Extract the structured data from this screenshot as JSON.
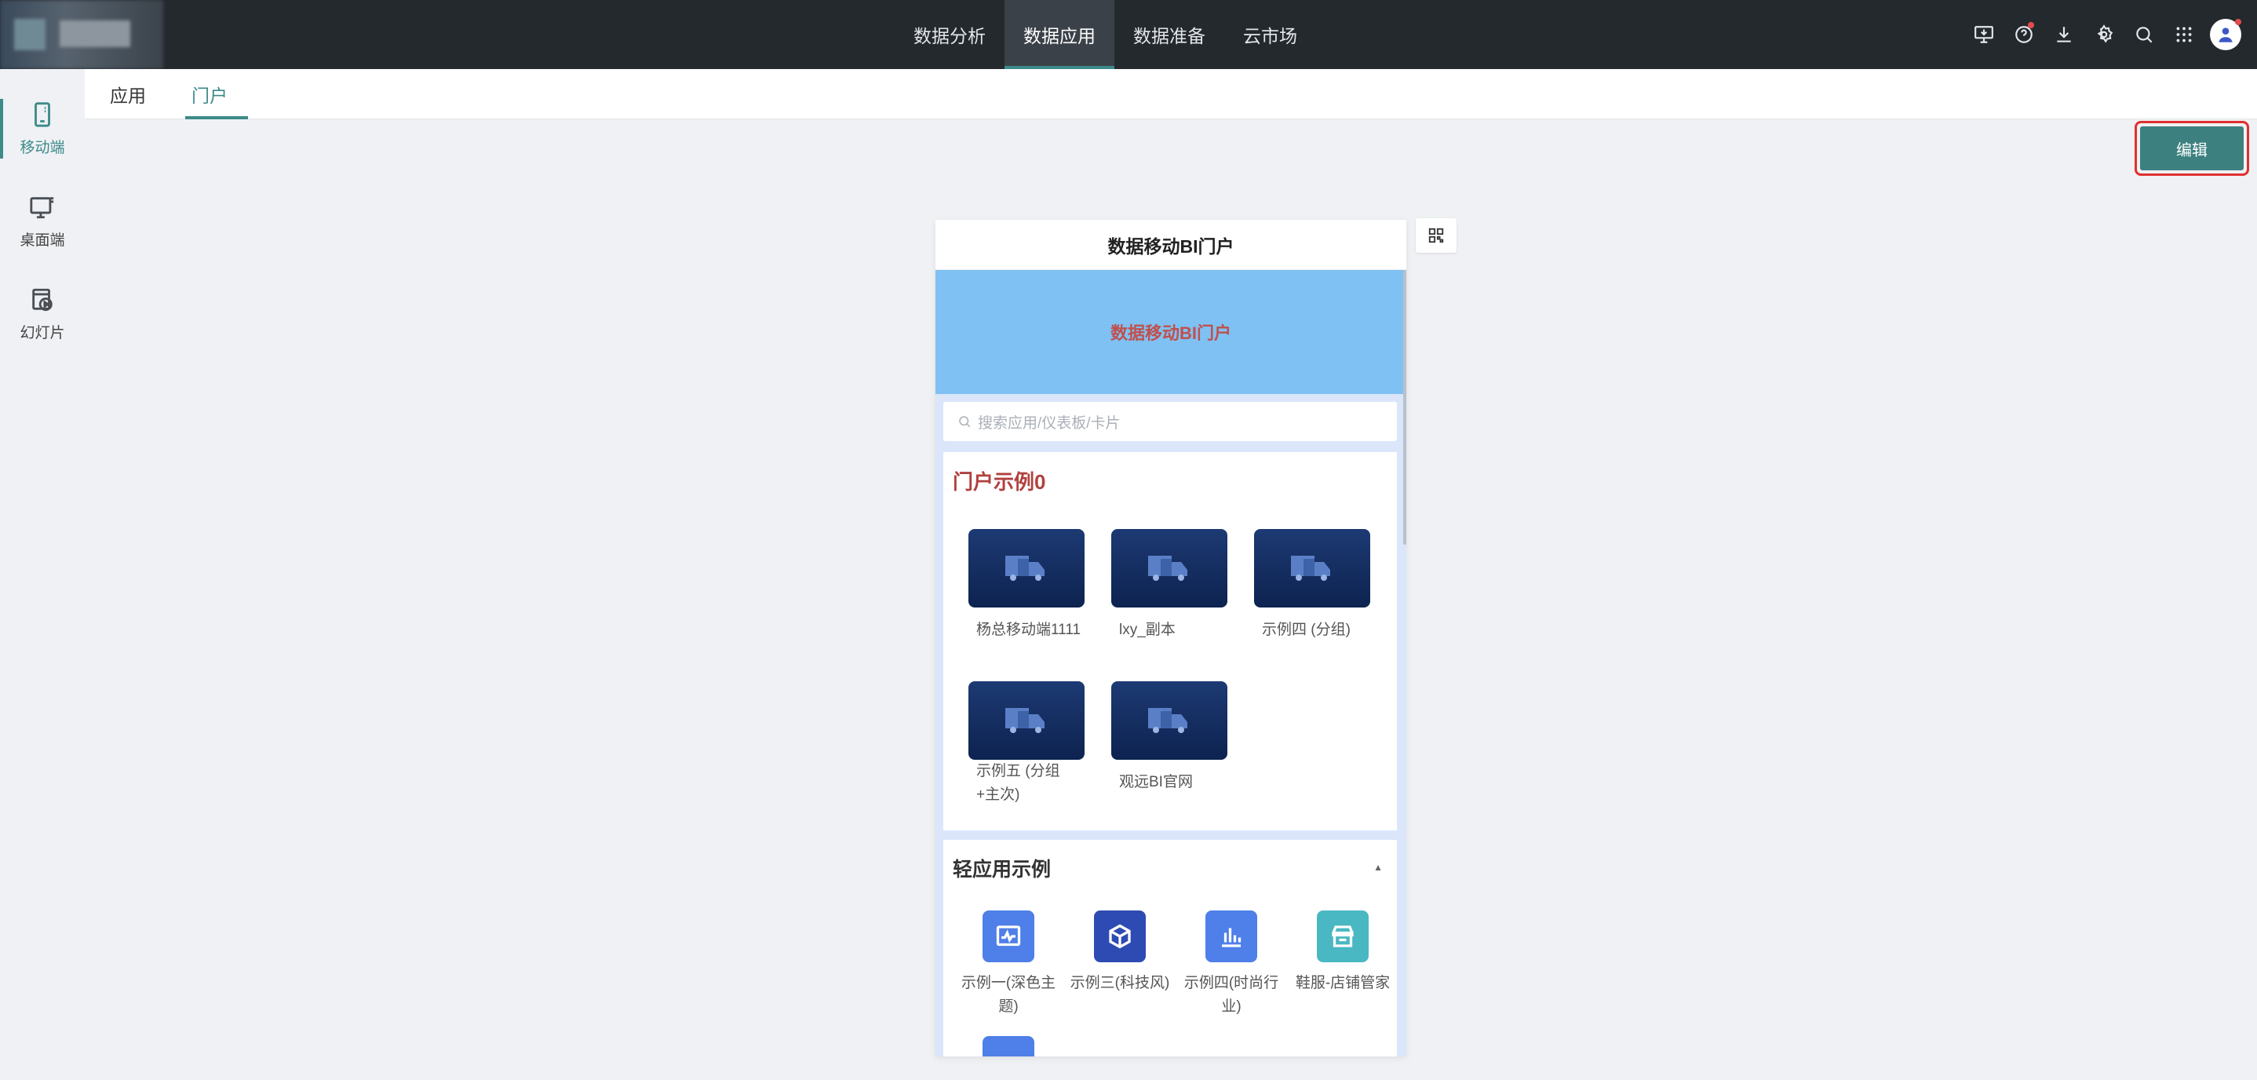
{
  "topnav": {
    "items": [
      "数据分析",
      "数据应用",
      "数据准备",
      "云市场"
    ],
    "active_index": 1
  },
  "top_icons": [
    "monitor-download-icon",
    "help-icon",
    "download-icon",
    "settings-icon",
    "search-icon",
    "apps-grid-icon"
  ],
  "sidebar": {
    "items": [
      {
        "label": "移动端",
        "icon": "mobile-icon"
      },
      {
        "label": "桌面端",
        "icon": "desktop-icon"
      },
      {
        "label": "幻灯片",
        "icon": "slideshow-icon"
      }
    ],
    "active_index": 0
  },
  "subtabs": {
    "items": [
      "应用",
      "门户"
    ],
    "active_index": 1
  },
  "edit_label": "编辑",
  "phone": {
    "title": "数据移动BI门户",
    "banner_text": "数据移动BI门户",
    "search_placeholder": "搜索应用/仪表板/卡片",
    "section1": {
      "title": "门户示例0",
      "apps": [
        {
          "label": "杨总移动端1111"
        },
        {
          "label": "lxy_副本"
        },
        {
          "label": "示例四 (分组)"
        },
        {
          "label": "示例五 (分组+主次)"
        },
        {
          "label": "观远BI官网"
        }
      ]
    },
    "section2": {
      "title": "轻应用示例",
      "items": [
        {
          "label": "示例一(深色主题)",
          "color": "#4f7fe8",
          "icon": "chart-window-icon"
        },
        {
          "label": "示例三(科技风)",
          "color": "#2e4bb3",
          "icon": "cube-icon"
        },
        {
          "label": "示例四(时尚行业)",
          "color": "#4f7fe8",
          "icon": "bar-chart-icon"
        },
        {
          "label": "鞋服-店铺管家",
          "color": "#49b8c2",
          "icon": "store-icon"
        }
      ]
    }
  },
  "colors": {
    "accent": "#3d8a8a",
    "topbar": "#24292e",
    "highlight": "#e03030"
  }
}
